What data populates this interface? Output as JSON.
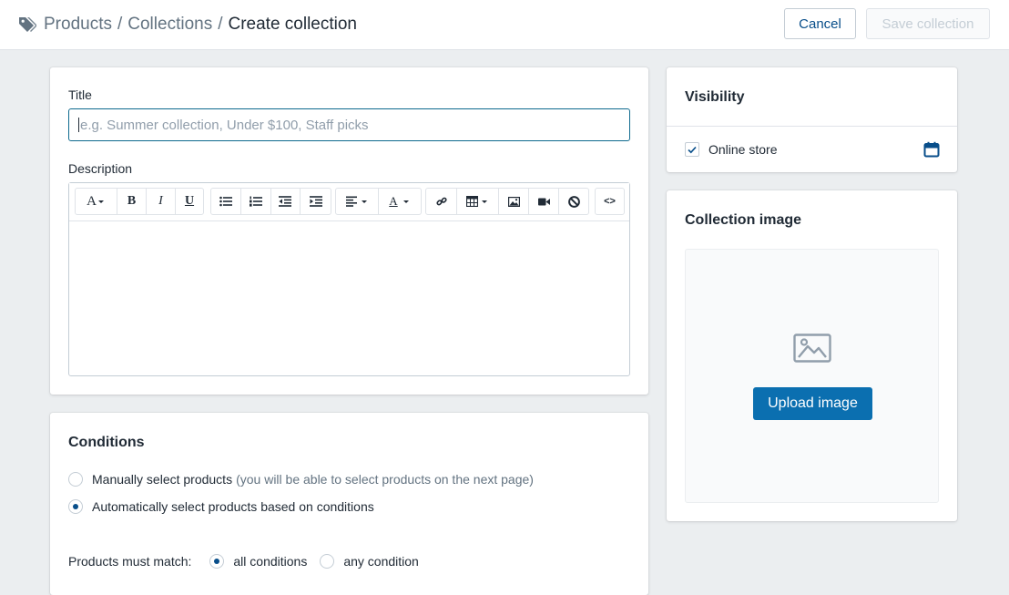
{
  "header": {
    "breadcrumb": {
      "products": "Products",
      "separator": "/",
      "collections": "Collections",
      "current": "Create collection"
    },
    "cancel_label": "Cancel",
    "save_label": "Save collection"
  },
  "main": {
    "title_label": "Title",
    "title_placeholder": "e.g. Summer collection, Under $100, Staff picks",
    "description_label": "Description",
    "toolbar": {
      "font_label": "A",
      "bold": "B",
      "italic": "I",
      "underline": "U",
      "text_color": "A",
      "html": "<>"
    }
  },
  "conditions": {
    "heading": "Conditions",
    "manual_label": "Manually select products",
    "manual_hint": "(you will be able to select products on the next page)",
    "auto_label": "Automatically select products based on conditions",
    "selected": "auto",
    "match_label": "Products must match:",
    "match_all": "all conditions",
    "match_any": "any condition",
    "match_selected": "all"
  },
  "visibility": {
    "heading": "Visibility",
    "online_store_label": "Online store",
    "online_store_checked": true
  },
  "collection_image": {
    "heading": "Collection image",
    "upload_label": "Upload image"
  },
  "colors": {
    "accent": "#084e8a",
    "upload_button": "#0b6fb0",
    "background": "#ebeef0"
  }
}
